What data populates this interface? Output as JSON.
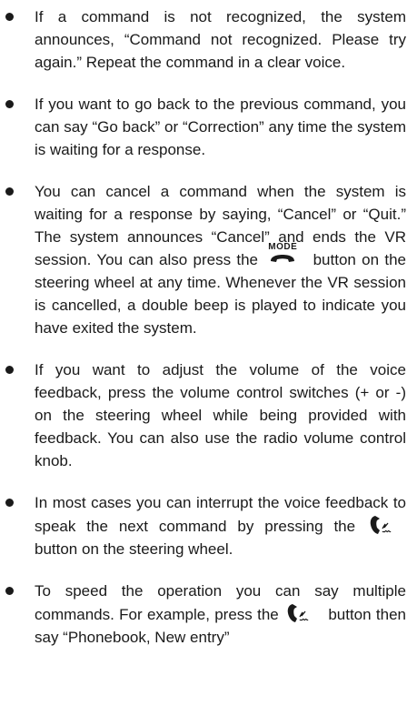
{
  "bullets": [
    {
      "text": "If a command is not recognized, the system announces, “Command not recognized. Please try again.” Repeat the command in a clear voice."
    },
    {
      "text": "If you want to go back to the previous command, you can say “Go back” or “Correction” any time the system is waiting for a response."
    },
    {
      "text_before": "You can cancel a command when the system is waiting for a response by saying, “Cancel” or “Quit.” The system announces “Cancel” and ends the VR session. You can also press the",
      "icon_label": "MODE",
      "icon": "mode-phone-icon",
      "text_after": "button on the steering wheel at any time. Whenever the VR session is cancelled, a double beep is played to indicate you have exited the system."
    },
    {
      "text": "If you want to adjust the volume of the voice feedback, press the volume control switches (+ or -) on the steering wheel while being provided with feedback. You can also use the radio volume control knob."
    },
    {
      "text_before": "In most cases you can interrupt the voice feedback to speak the next command by pressing the",
      "icon": "phone-talk-icon",
      "text_after": "button on the steering wheel."
    },
    {
      "text_before": "To speed the operation you can say multiple commands. For example, press the",
      "icon": "phone-talk-icon",
      "text_after": "button then say “Phonebook, New entry”"
    }
  ]
}
